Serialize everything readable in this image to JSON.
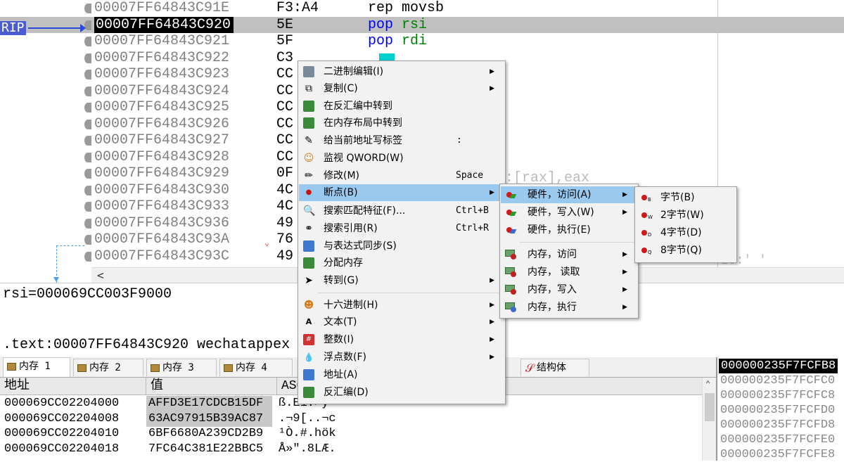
{
  "disasm": {
    "rip_label": "RIP",
    "rows": [
      {
        "addr": "00007FF64843C91E",
        "bytes": "F3:A4",
        "mnemonic": "rep movsb",
        "operand": ""
      },
      {
        "addr": "00007FF64843C920",
        "bytes": "5E",
        "mnemonic": "pop",
        "operand": "rsi"
      },
      {
        "addr": "00007FF64843C921",
        "bytes": "5F",
        "mnemonic": "pop",
        "operand": "rdi"
      },
      {
        "addr": "00007FF64843C922",
        "bytes": "C3",
        "mnemonic": "",
        "operand": ""
      },
      {
        "addr": "00007FF64843C923",
        "bytes": "CC",
        "mnemonic": "",
        "operand": ""
      },
      {
        "addr": "00007FF64843C924",
        "bytes": "CC",
        "mnemonic": "",
        "operand": ""
      },
      {
        "addr": "00007FF64843C925",
        "bytes": "CC",
        "mnemonic": "",
        "operand": ""
      },
      {
        "addr": "00007FF64843C926",
        "bytes": "CC",
        "mnemonic": "",
        "operand": ""
      },
      {
        "addr": "00007FF64843C927",
        "bytes": "CC",
        "mnemonic": "",
        "operand": ""
      },
      {
        "addr": "00007FF64843C928",
        "bytes": "CC",
        "mnemonic": "",
        "operand": ""
      },
      {
        "addr": "00007FF64843C929",
        "bytes": "0F",
        "mnemonic": "",
        "operand": ""
      },
      {
        "addr": "00007FF64843C930",
        "bytes": "4C",
        "mnemonic": "",
        "operand": ""
      },
      {
        "addr": "00007FF64843C933",
        "bytes": "4C",
        "mnemonic": "",
        "operand": ""
      },
      {
        "addr": "00007FF64843C936",
        "bytes": "49",
        "mnemonic": "",
        "operand": ""
      },
      {
        "addr": "00007FF64843C93A",
        "bytes": "76",
        "mnemonic": "",
        "operand": ""
      },
      {
        "addr": "00007FF64843C93C",
        "bytes": "49",
        "mnemonic": "",
        "operand": ""
      }
    ],
    "ghost_operands": "s:[rax],eax",
    "ghost_right": "20:' '",
    "scroll_left_glyph": "<"
  },
  "info": {
    "rsi_line": "rsi=000069CC003F9000",
    "text_line": ".text:00007FF64843C920 wechatappex"
  },
  "tabs": [
    {
      "label": "内存 1",
      "active": true
    },
    {
      "label": "内存 2",
      "active": false
    },
    {
      "label": "内存 3",
      "active": false
    },
    {
      "label": "内存 4",
      "active": false
    },
    {
      "label": "结构体",
      "active": false
    }
  ],
  "dump": {
    "headers": {
      "addr": "地址",
      "value": "值",
      "ascii": "ASC"
    },
    "rows": [
      {
        "addr": "000069CC02204000",
        "value": "AFFD3E17CDCB15DF",
        "ascii": "ß.E1.>y",
        "hl": true
      },
      {
        "addr": "000069CC02204008",
        "value": "63AC97915B39AC87",
        "ascii": ".¬9[..¬c",
        "hl": true
      },
      {
        "addr": "000069CC02204010",
        "value": "6BF6680A239CD2B9",
        "ascii": "¹Ò.#.hök",
        "hl": false
      },
      {
        "addr": "000069CC02204018",
        "value": "7FC64C381E22BBC5",
        "ascii": "Å»\".8LÆ.",
        "hl": false
      }
    ]
  },
  "stack": {
    "rows": [
      "000000235F7FCFB8",
      "000000235F7FCFC0",
      "000000235F7FCFC8",
      "000000235F7FCFD0",
      "000000235F7FCFD8",
      "000000235F7FCFE0",
      "000000235F7FCFE8"
    ]
  },
  "menu_main": {
    "items": [
      {
        "label": "二进制编辑(I)",
        "shortcut": "",
        "submenu": true,
        "icon": "binary-edit-icon"
      },
      {
        "label": "复制(C)",
        "shortcut": "",
        "submenu": true,
        "icon": "copy-icon"
      },
      {
        "label": "在反汇编中转到",
        "shortcut": "",
        "submenu": false,
        "icon": "goto-disasm-icon"
      },
      {
        "label": "在内存布局中转到",
        "shortcut": "",
        "submenu": false,
        "icon": "goto-memmap-icon"
      },
      {
        "label": "给当前地址写标签",
        "shortcut": ":",
        "submenu": false,
        "icon": "label-icon"
      },
      {
        "label": "监视 QWORD(W)",
        "shortcut": "",
        "submenu": false,
        "icon": "watch-icon"
      },
      {
        "label": "修改(M)",
        "shortcut": "Space",
        "submenu": false,
        "icon": "pencil-icon"
      },
      {
        "label": "断点(B)",
        "shortcut": "",
        "submenu": true,
        "icon": "breakpoint-icon"
      },
      {
        "label": "搜索匹配特征(F)...",
        "shortcut": "Ctrl+B",
        "submenu": false,
        "icon": "search-pattern-icon"
      },
      {
        "label": "搜索引用(R)",
        "shortcut": "Ctrl+R",
        "submenu": false,
        "icon": "binoculars-icon"
      },
      {
        "label": "与表达式同步(S)",
        "shortcut": "",
        "submenu": false,
        "icon": "sync-icon"
      },
      {
        "label": "分配内存",
        "shortcut": "",
        "submenu": false,
        "icon": "allocate-memory-icon"
      },
      {
        "label": "转到(G)",
        "shortcut": "",
        "submenu": true,
        "icon": "goto-icon"
      },
      {
        "label": "十六进制(H)",
        "shortcut": "",
        "submenu": true,
        "icon": "hex-icon"
      },
      {
        "label": "文本(T)",
        "shortcut": "",
        "submenu": true,
        "icon": "text-icon"
      },
      {
        "label": "整数(I)",
        "shortcut": "",
        "submenu": true,
        "icon": "integer-icon"
      },
      {
        "label": "浮点数(F)",
        "shortcut": "",
        "submenu": true,
        "icon": "float-icon"
      },
      {
        "label": "地址(A)",
        "shortcut": "",
        "submenu": false,
        "icon": "address-icon"
      },
      {
        "label": "反汇编(D)",
        "shortcut": "",
        "submenu": false,
        "icon": "disassembly-icon"
      }
    ]
  },
  "menu_bp": {
    "items": [
      {
        "label": "硬件，访问(A)",
        "submenu": true
      },
      {
        "label": "硬件，写入(W)",
        "submenu": true
      },
      {
        "label": "硬件，执行(E)",
        "submenu": false
      },
      {
        "label": "内存，访问",
        "submenu": true
      },
      {
        "label": "内存， 读取",
        "submenu": true
      },
      {
        "label": "内存，写入",
        "submenu": true
      },
      {
        "label": "内存，执行",
        "submenu": true
      }
    ]
  },
  "menu_size": {
    "items": [
      {
        "label": "字节(B)",
        "sub": "B"
      },
      {
        "label": "2字节(W)",
        "sub": "W"
      },
      {
        "label": "4字节(D)",
        "sub": "D"
      },
      {
        "label": "8字节(Q)",
        "sub": "Q"
      }
    ]
  },
  "colors": {
    "menu_highlight": "#99c9ef",
    "rip_badge": "#4a5cd0",
    "keyword": "#0000ff",
    "register": "#008000"
  }
}
